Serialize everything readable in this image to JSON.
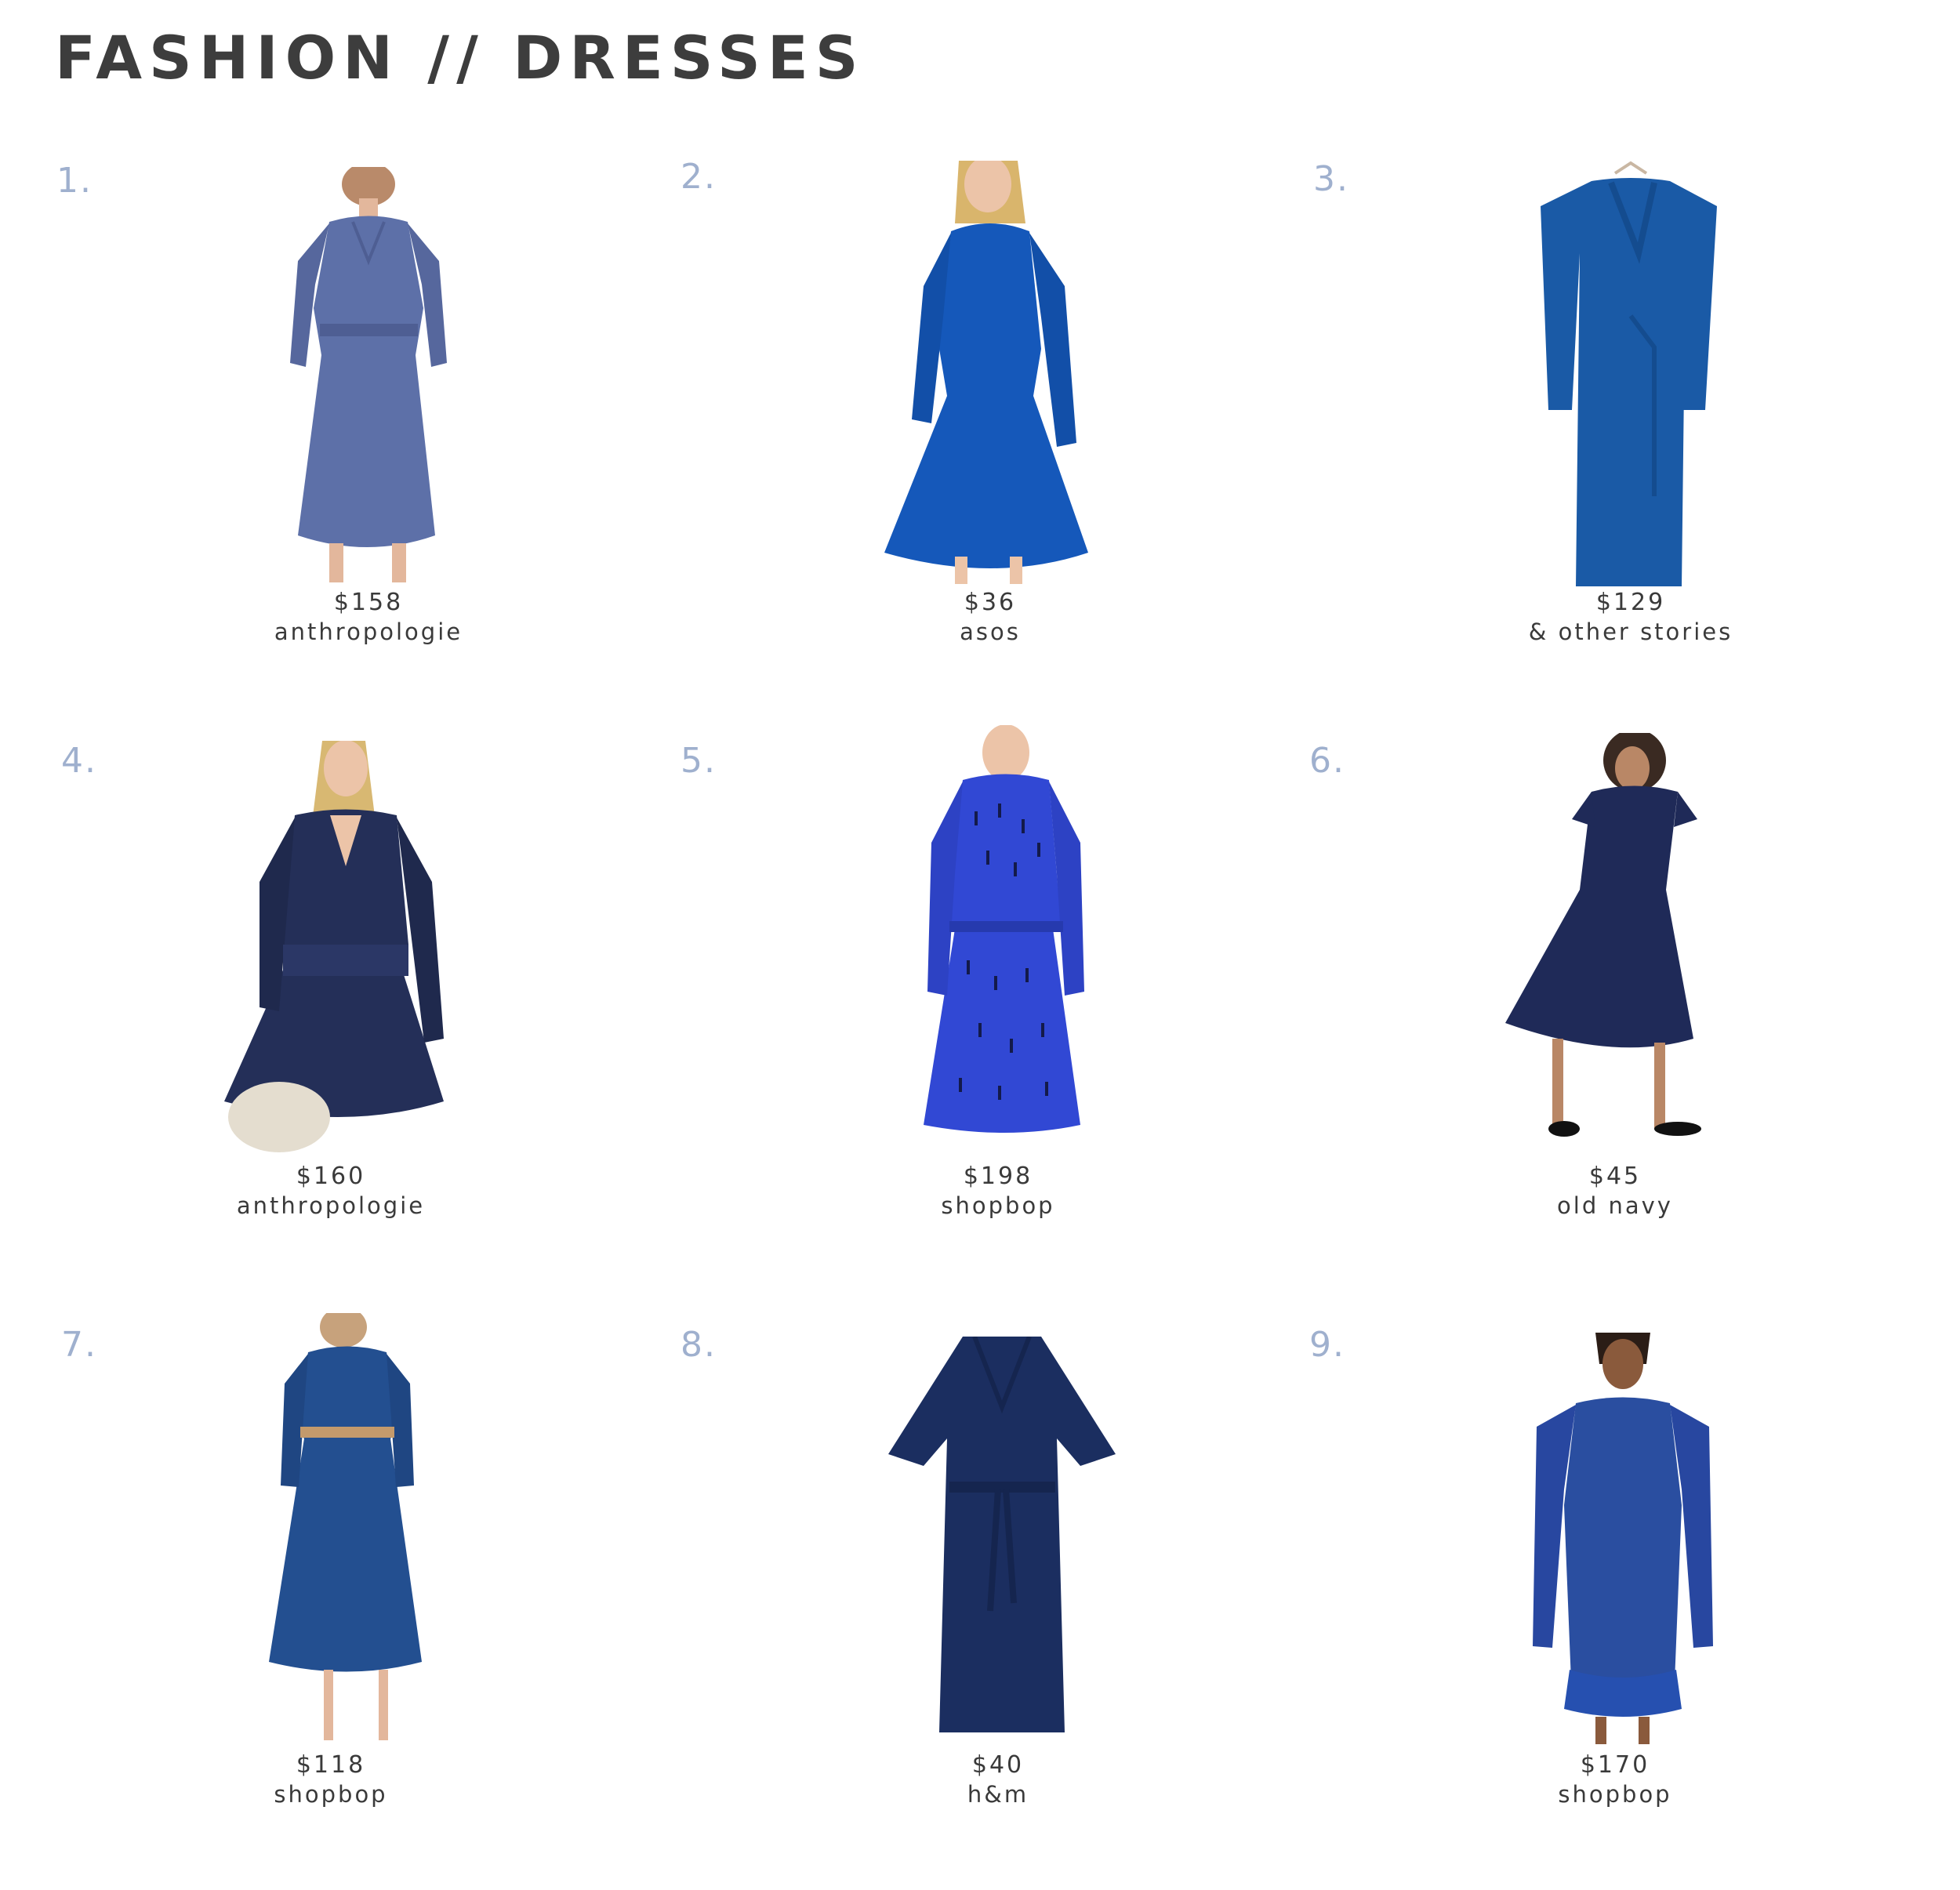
{
  "header": {
    "title": "FASHION // DRESSES"
  },
  "colors": {
    "number": "#9fb0ce",
    "title": "#3d3d3d",
    "caption": "#3a3a3a"
  },
  "products": [
    {
      "number": "1.",
      "price": "$158",
      "store": "anthropologie",
      "dress_color": "#5d70a8",
      "style": "v-neck-puff-sleeve-midi"
    },
    {
      "number": "2.",
      "price": "$36",
      "store": "asos",
      "dress_color": "#1558ba",
      "style": "long-sleeve-skater-mini"
    },
    {
      "number": "3.",
      "price": "$129",
      "store": "& other stories",
      "dress_color": "#1a5aa6",
      "style": "ruffle-wrap-maxi"
    },
    {
      "number": "4.",
      "price": "$160",
      "store": "anthropologie",
      "dress_color": "#242f58",
      "style": "v-neck-tiered-mini"
    },
    {
      "number": "5.",
      "price": "$198",
      "store": "shopbop",
      "dress_color": "#3148d4",
      "style": "printed-belted-mini"
    },
    {
      "number": "6.",
      "price": "$45",
      "store": "old navy",
      "dress_color": "#1f2a58",
      "style": "flutter-sleeve-midi"
    },
    {
      "number": "7.",
      "price": "$118",
      "store": "shopbop",
      "dress_color": "#234f90",
      "style": "puff-sleeve-belted-midi"
    },
    {
      "number": "8.",
      "price": "$40",
      "store": "h&m",
      "dress_color": "#1b2e60",
      "style": "wide-sleeve-wrap-midi"
    },
    {
      "number": "9.",
      "price": "$170",
      "store": "shopbop",
      "dress_color": "#2a4ea0",
      "style": "smocked-ruffle-mini"
    }
  ]
}
